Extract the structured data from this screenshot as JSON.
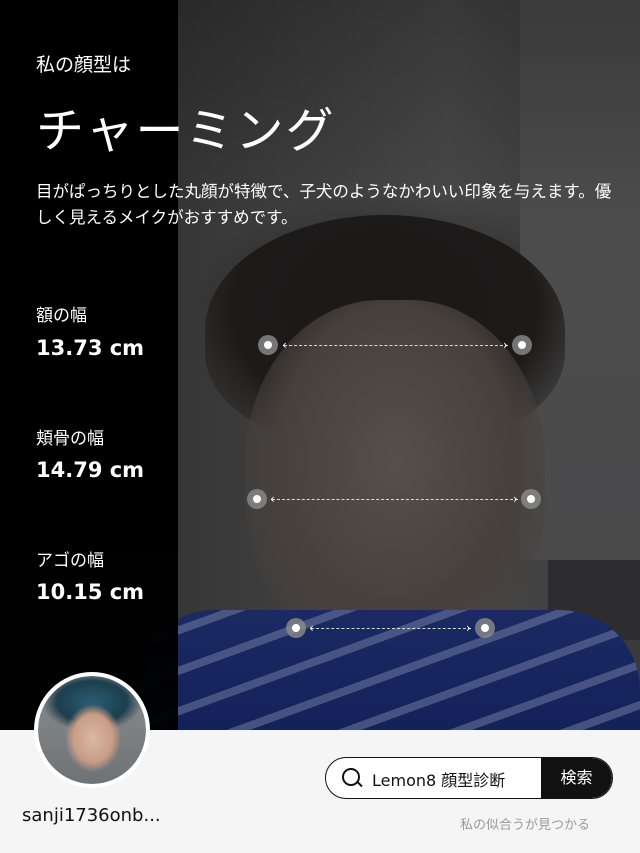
{
  "header": {
    "subtitle": "私の顔型は",
    "type_name": "チャーミング",
    "description": "目がぱっちりとした丸顔が特徴で、子犬のようなかわいい印象を与えます。優しく見えるメイクがおすすめです。"
  },
  "metrics": [
    {
      "label": "額の幅",
      "value": "13.73 cm"
    },
    {
      "label": "頬骨の幅",
      "value": "14.79 cm"
    },
    {
      "label": "アゴの幅",
      "value": "10.15 cm"
    }
  ],
  "footer": {
    "username": "sanji1736onb...",
    "search_text": "Lemon8 顔型診断",
    "search_button": "検索",
    "tagline": "私の似合うが見つかる"
  },
  "icons": {
    "search": "search-icon",
    "avatar": "avatar"
  },
  "colors": {
    "panel": "#000000",
    "bottom_bar": "#f5f5f5",
    "search_button": "#111111"
  }
}
